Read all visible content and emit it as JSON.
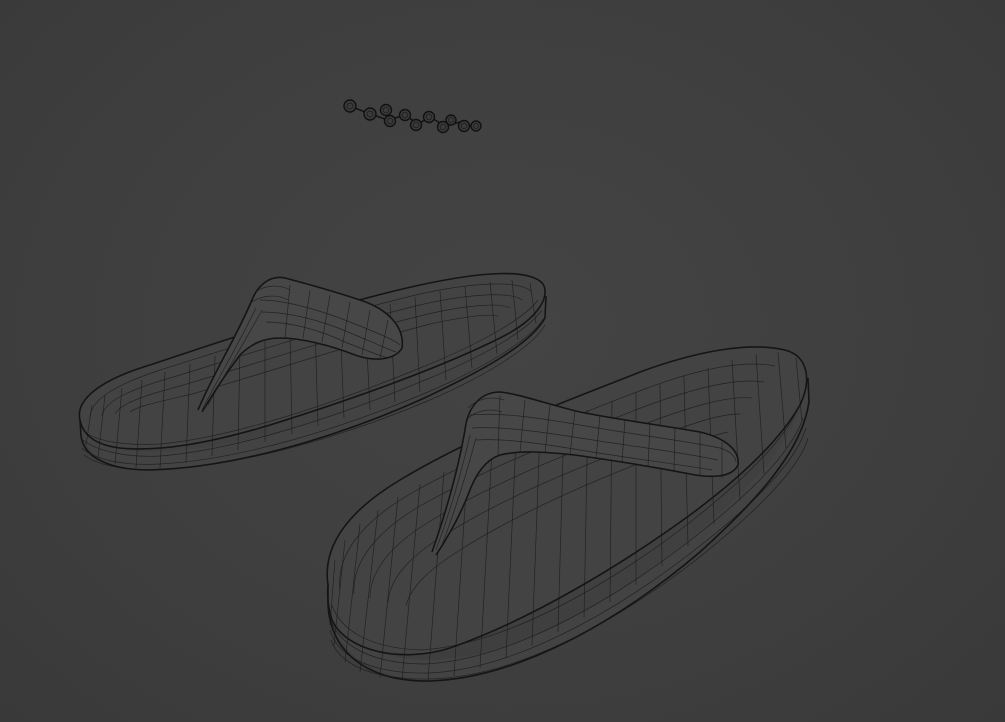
{
  "viewport": {
    "mode": "3d-viewport",
    "shading": "wireframe",
    "background_color": "#404040",
    "wire_color": "#1c1c1c"
  },
  "objects": [
    {
      "id": "slipper-left",
      "kind": "flip-flop mesh"
    },
    {
      "id": "slipper-right",
      "kind": "flip-flop mesh"
    },
    {
      "id": "bead-chain",
      "kind": "bead chain mesh",
      "bead_count": 11
    }
  ]
}
